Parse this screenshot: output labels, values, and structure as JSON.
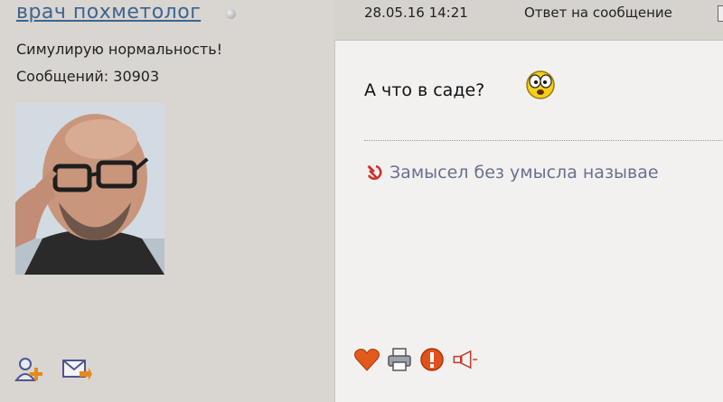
{
  "user": {
    "name": "врач  похметолог",
    "title": "Симулирую нормальность!",
    "post_count": "Сообщений: 30903"
  },
  "post": {
    "date": "28.05.16 14:21",
    "reply_label": "Ответ на сообщение",
    "text": "А что в саде?",
    "signature": "Замысел без умысла называе"
  },
  "icons": {
    "status": "offline-status-icon",
    "add_friend": "add-friend-icon",
    "private_message": "private-message-icon",
    "like": "heart-icon",
    "print": "printer-icon",
    "report": "warning-icon",
    "quote": "megaphone-icon",
    "smiley": "surprised-smiley-icon",
    "signature": "hammer-sickle-icon"
  },
  "colors": {
    "username": "#3e6490",
    "signature": "#6a6f8f",
    "accent": "#d04a1a"
  }
}
